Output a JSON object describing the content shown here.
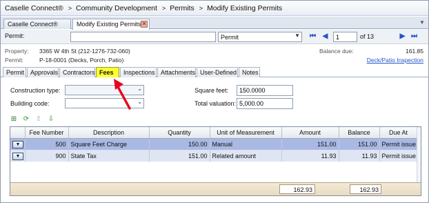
{
  "breadcrumb": {
    "items": [
      "Caselle Connect®",
      "Community Development",
      "Permits",
      "Modify Existing Permits"
    ],
    "separator": ">"
  },
  "doc_tabs": [
    {
      "label": "Caselle Connect®"
    },
    {
      "label": "Modify Existing Permits"
    }
  ],
  "nav": {
    "permit_label": "Permit:",
    "search_value": "",
    "type_select": "Permit",
    "page_value": "1",
    "page_of": "of 13"
  },
  "info": {
    "property_label": "Property:",
    "property_value": "3365 W 4th St (212-1276-732-060)",
    "permit_label": "Permit:",
    "permit_value": "P-18-0001 (Decks, Porch, Patio)",
    "balance_label": "Balance due:",
    "balance_value": "161.85",
    "inspection_link": "Deck/Patio Inspection"
  },
  "section_tabs": [
    "Permit",
    "Approvals",
    "Contractors",
    "Fees",
    "Inspections",
    "Attachments",
    "User-Defined",
    "Notes"
  ],
  "active_tab": "Fees",
  "fields": {
    "construction_type_label": "Construction type:",
    "construction_type_value": "",
    "building_code_label": "Building code:",
    "building_code_value": "",
    "square_feet_label": "Square feet:",
    "square_feet_value": "150.0000",
    "total_valuation_label": "Total valuation:",
    "total_valuation_value": "5,000.00"
  },
  "grid": {
    "columns": [
      "Fee Number",
      "Description",
      "Quantity",
      "Unit of Measurement",
      "Amount",
      "Balance",
      "Due At"
    ],
    "rows": [
      {
        "fee_number": "500",
        "description": "Square Feet Charge",
        "quantity": "150.00",
        "unit": "Manual",
        "amount": "151.00",
        "balance": "151.00",
        "due_at": "Permit issue"
      },
      {
        "fee_number": "900",
        "description": "State Tax",
        "quantity": "151.00",
        "unit": "Related amount",
        "amount": "11.93",
        "balance": "11.93",
        "due_at": "Permit issue"
      }
    ],
    "totals": {
      "amount": "162.93",
      "balance": "162.93"
    }
  },
  "colors": {
    "highlight_tab": "#ffff33",
    "selected_row": "#a9b9e3",
    "annotation_arrow": "#e8001c",
    "link": "#2255cc"
  }
}
